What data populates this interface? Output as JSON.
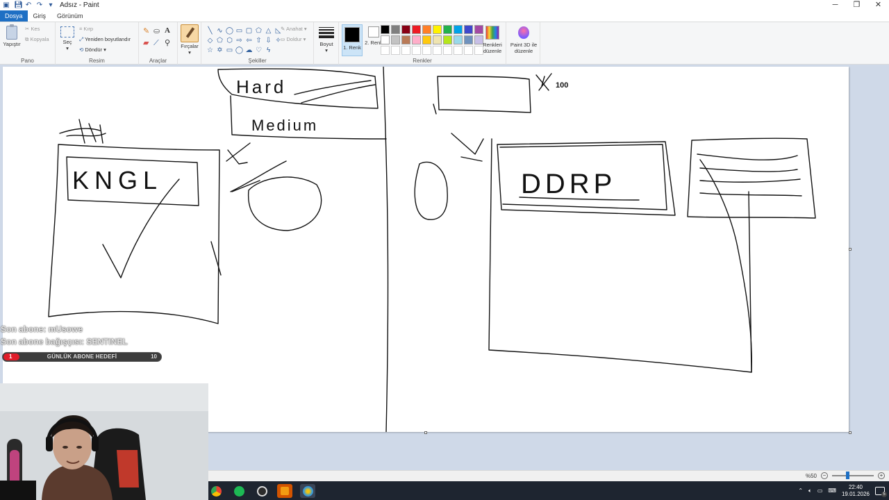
{
  "window": {
    "title": "Adsız - Paint",
    "controls": [
      "minimize-icon",
      "restore-icon",
      "close-icon"
    ]
  },
  "menu": {
    "tabs": [
      "Dosya",
      "Giriş",
      "Görünüm"
    ]
  },
  "ribbon": {
    "clipboard": {
      "label": "Pano",
      "paste": "Yapıştır",
      "cut": "Kes",
      "copy": "Kopyala"
    },
    "image": {
      "label": "Resim",
      "select": "Seç",
      "crop": "Kırp",
      "resize": "Yeniden boyutlandır",
      "rotate": "Döndür"
    },
    "tools": {
      "label": "Araçlar"
    },
    "brushes": {
      "label": "Fırçalar"
    },
    "shapes": {
      "label": "Şekiller",
      "outline": "Anahat",
      "fill": "Doldur"
    },
    "size": {
      "label": "Boyut"
    },
    "colors": {
      "label": "Renkler",
      "color1": "1. Renk",
      "color2": "2. Renk",
      "edit": "Renkleri düzenle",
      "color1_value": "#000000",
      "color2_value": "#ffffff",
      "palette": [
        "#000000",
        "#7f7f7f",
        "#880015",
        "#ed1c24",
        "#ff7f27",
        "#fff200",
        "#22b14c",
        "#00a2e8",
        "#3f48cc",
        "#a349a4",
        "#ffffff",
        "#c3c3c3",
        "#b97a57",
        "#ffaec9",
        "#ffc90e",
        "#efe4b0",
        "#b5e61d",
        "#99d9ea",
        "#7092be",
        "#c8bfe7",
        "#ffffff",
        "#ffffff",
        "#ffffff",
        "#ffffff",
        "#ffffff",
        "#ffffff",
        "#ffffff",
        "#ffffff",
        "#ffffff",
        "#ffffff"
      ]
    },
    "paint3d": {
      "label": "Paint 3D ile düzenle"
    }
  },
  "canvas": {
    "drawn_text": [
      "Hard",
      "Medium",
      "KNGL",
      "DDRP",
      "100"
    ]
  },
  "status": {
    "zoom": "%50"
  },
  "overlay": {
    "last_sub": "Son abone: mUsowe",
    "last_gift": "Son abone bağışçısı: SENTINEL",
    "goal_label": "GÜNLÜK ABONE HEDEFİ",
    "goal_current": "1",
    "goal_target": "10",
    "goal_progress": 0.1
  },
  "taskbar": {
    "apps": [
      "chrome-icon",
      "spotify-icon",
      "obs-icon",
      "app-icon",
      "paint-icon"
    ],
    "time": "22:40",
    "date": "19.01.2026",
    "notification_count": "5"
  }
}
